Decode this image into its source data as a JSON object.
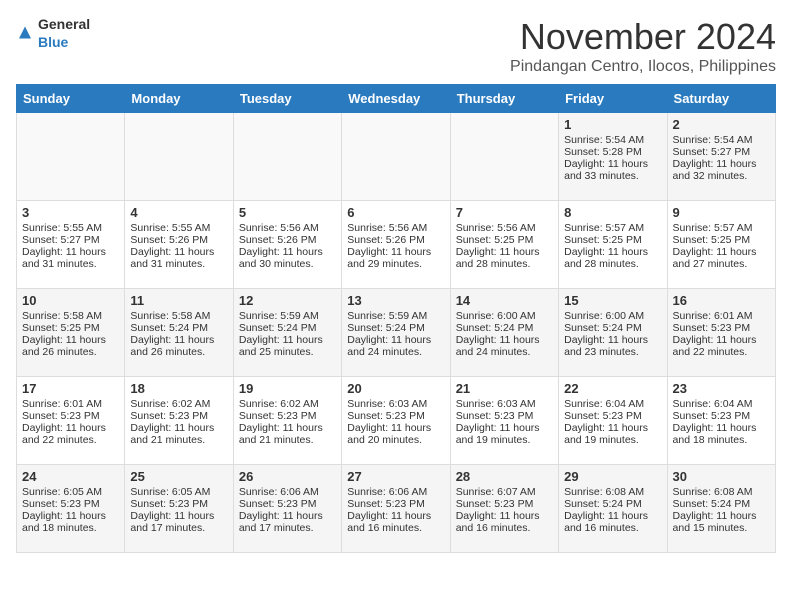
{
  "header": {
    "logo_general": "General",
    "logo_blue": "Blue",
    "month": "November 2024",
    "location": "Pindangan Centro, Ilocos, Philippines"
  },
  "days_of_week": [
    "Sunday",
    "Monday",
    "Tuesday",
    "Wednesday",
    "Thursday",
    "Friday",
    "Saturday"
  ],
  "weeks": [
    [
      {
        "day": "",
        "info": ""
      },
      {
        "day": "",
        "info": ""
      },
      {
        "day": "",
        "info": ""
      },
      {
        "day": "",
        "info": ""
      },
      {
        "day": "",
        "info": ""
      },
      {
        "day": "1",
        "info": "Sunrise: 5:54 AM\nSunset: 5:28 PM\nDaylight: 11 hours and 33 minutes."
      },
      {
        "day": "2",
        "info": "Sunrise: 5:54 AM\nSunset: 5:27 PM\nDaylight: 11 hours and 32 minutes."
      }
    ],
    [
      {
        "day": "3",
        "info": "Sunrise: 5:55 AM\nSunset: 5:27 PM\nDaylight: 11 hours and 31 minutes."
      },
      {
        "day": "4",
        "info": "Sunrise: 5:55 AM\nSunset: 5:26 PM\nDaylight: 11 hours and 31 minutes."
      },
      {
        "day": "5",
        "info": "Sunrise: 5:56 AM\nSunset: 5:26 PM\nDaylight: 11 hours and 30 minutes."
      },
      {
        "day": "6",
        "info": "Sunrise: 5:56 AM\nSunset: 5:26 PM\nDaylight: 11 hours and 29 minutes."
      },
      {
        "day": "7",
        "info": "Sunrise: 5:56 AM\nSunset: 5:25 PM\nDaylight: 11 hours and 28 minutes."
      },
      {
        "day": "8",
        "info": "Sunrise: 5:57 AM\nSunset: 5:25 PM\nDaylight: 11 hours and 28 minutes."
      },
      {
        "day": "9",
        "info": "Sunrise: 5:57 AM\nSunset: 5:25 PM\nDaylight: 11 hours and 27 minutes."
      }
    ],
    [
      {
        "day": "10",
        "info": "Sunrise: 5:58 AM\nSunset: 5:25 PM\nDaylight: 11 hours and 26 minutes."
      },
      {
        "day": "11",
        "info": "Sunrise: 5:58 AM\nSunset: 5:24 PM\nDaylight: 11 hours and 26 minutes."
      },
      {
        "day": "12",
        "info": "Sunrise: 5:59 AM\nSunset: 5:24 PM\nDaylight: 11 hours and 25 minutes."
      },
      {
        "day": "13",
        "info": "Sunrise: 5:59 AM\nSunset: 5:24 PM\nDaylight: 11 hours and 24 minutes."
      },
      {
        "day": "14",
        "info": "Sunrise: 6:00 AM\nSunset: 5:24 PM\nDaylight: 11 hours and 24 minutes."
      },
      {
        "day": "15",
        "info": "Sunrise: 6:00 AM\nSunset: 5:24 PM\nDaylight: 11 hours and 23 minutes."
      },
      {
        "day": "16",
        "info": "Sunrise: 6:01 AM\nSunset: 5:23 PM\nDaylight: 11 hours and 22 minutes."
      }
    ],
    [
      {
        "day": "17",
        "info": "Sunrise: 6:01 AM\nSunset: 5:23 PM\nDaylight: 11 hours and 22 minutes."
      },
      {
        "day": "18",
        "info": "Sunrise: 6:02 AM\nSunset: 5:23 PM\nDaylight: 11 hours and 21 minutes."
      },
      {
        "day": "19",
        "info": "Sunrise: 6:02 AM\nSunset: 5:23 PM\nDaylight: 11 hours and 21 minutes."
      },
      {
        "day": "20",
        "info": "Sunrise: 6:03 AM\nSunset: 5:23 PM\nDaylight: 11 hours and 20 minutes."
      },
      {
        "day": "21",
        "info": "Sunrise: 6:03 AM\nSunset: 5:23 PM\nDaylight: 11 hours and 19 minutes."
      },
      {
        "day": "22",
        "info": "Sunrise: 6:04 AM\nSunset: 5:23 PM\nDaylight: 11 hours and 19 minutes."
      },
      {
        "day": "23",
        "info": "Sunrise: 6:04 AM\nSunset: 5:23 PM\nDaylight: 11 hours and 18 minutes."
      }
    ],
    [
      {
        "day": "24",
        "info": "Sunrise: 6:05 AM\nSunset: 5:23 PM\nDaylight: 11 hours and 18 minutes."
      },
      {
        "day": "25",
        "info": "Sunrise: 6:05 AM\nSunset: 5:23 PM\nDaylight: 11 hours and 17 minutes."
      },
      {
        "day": "26",
        "info": "Sunrise: 6:06 AM\nSunset: 5:23 PM\nDaylight: 11 hours and 17 minutes."
      },
      {
        "day": "27",
        "info": "Sunrise: 6:06 AM\nSunset: 5:23 PM\nDaylight: 11 hours and 16 minutes."
      },
      {
        "day": "28",
        "info": "Sunrise: 6:07 AM\nSunset: 5:23 PM\nDaylight: 11 hours and 16 minutes."
      },
      {
        "day": "29",
        "info": "Sunrise: 6:08 AM\nSunset: 5:24 PM\nDaylight: 11 hours and 16 minutes."
      },
      {
        "day": "30",
        "info": "Sunrise: 6:08 AM\nSunset: 5:24 PM\nDaylight: 11 hours and 15 minutes."
      }
    ]
  ]
}
